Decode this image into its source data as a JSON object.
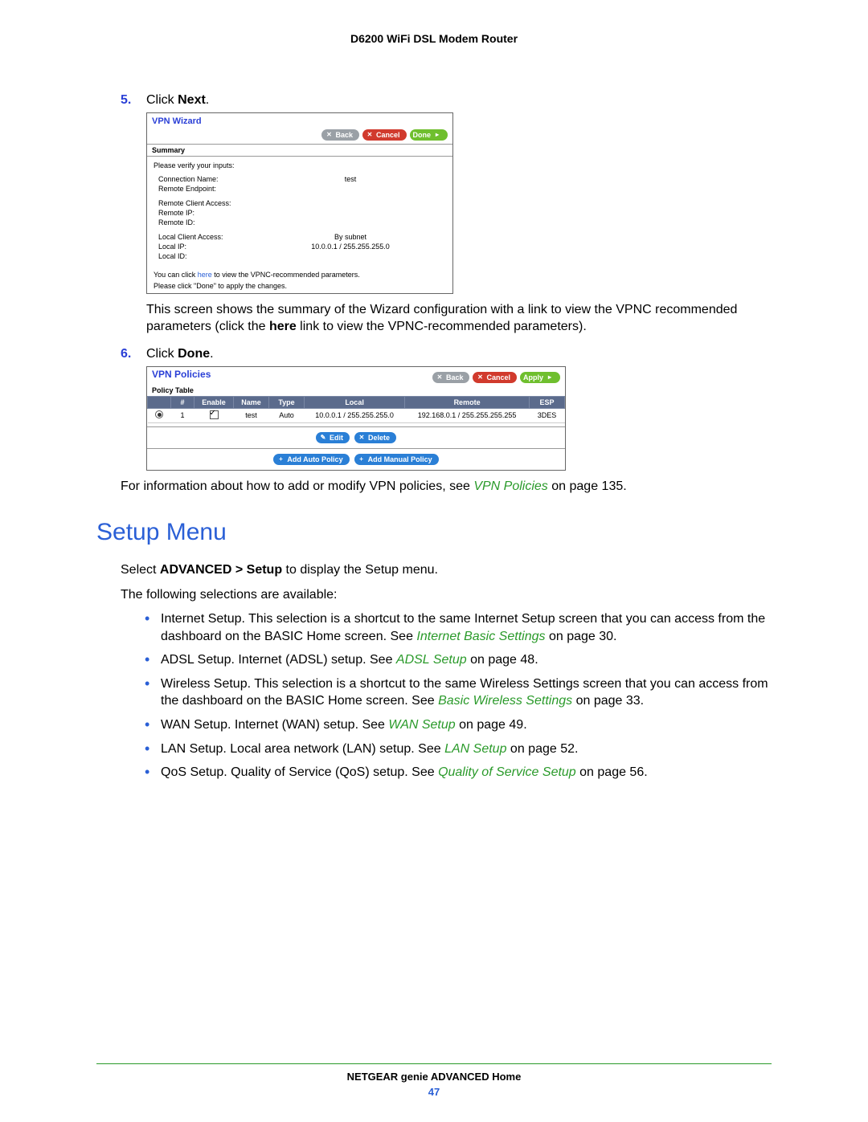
{
  "doc_header": "D6200 WiFi DSL Modem Router",
  "steps": {
    "five": {
      "num": "5.",
      "lead": "Click ",
      "bold": "Next",
      "trail": "."
    },
    "six": {
      "num": "6.",
      "lead": "Click ",
      "bold": "Done",
      "trail": "."
    }
  },
  "wizard": {
    "title": "VPN Wizard",
    "buttons": {
      "back": "Back",
      "cancel": "Cancel",
      "done": "Done"
    },
    "summary_head": "Summary",
    "verify": "Please verify your inputs:",
    "rows": {
      "conn_name": {
        "k": "Connection Name:",
        "v": "test"
      },
      "remote_ep": {
        "k": "Remote Endpoint:",
        "v": ""
      },
      "rca": {
        "k": "Remote Client Access:",
        "v": ""
      },
      "rip": {
        "k": "Remote IP:",
        "v": ""
      },
      "rid": {
        "k": "Remote ID:",
        "v": ""
      },
      "lca": {
        "k": "Local Client Access:",
        "v": "By subnet"
      },
      "lip": {
        "k": "Local IP:",
        "v": "10.0.0.1 / 255.255.255.0"
      },
      "lid": {
        "k": "Local ID:",
        "v": ""
      }
    },
    "note1a": "You can click ",
    "note1_here": "here",
    "note1b": " to view the VPNC-recommended parameters.",
    "note2": "Please click \"Done\" to apply the changes."
  },
  "wizard_caption_before": "This screen shows the summary of the Wizard configuration with a link to view the VPNC recommended parameters (click the ",
  "wizard_caption_bold": "here",
  "wizard_caption_after": " link to view the VPNC-recommended parameters).",
  "policies": {
    "title": "VPN Policies",
    "buttons": {
      "back": "Back",
      "cancel": "Cancel",
      "apply": "Apply"
    },
    "subtitle": "Policy Table",
    "headers": {
      "sel": "",
      "num": "#",
      "enable": "Enable",
      "name": "Name",
      "type": "Type",
      "local": "Local",
      "remote": "Remote",
      "esp": "ESP"
    },
    "row1": {
      "num": "1",
      "enable": true,
      "name": "test",
      "type": "Auto",
      "local": "10.0.0.1 / 255.255.255.0",
      "remote": "192.168.0.1 / 255.255.255.255",
      "esp": "3DES"
    },
    "action_buttons": {
      "edit": "Edit",
      "delete": "Delete",
      "add_auto": "Add Auto Policy",
      "add_manual": "Add Manual Policy"
    }
  },
  "policies_caption_before": "For information about how to add or modify VPN policies, see ",
  "policies_caption_link": "VPN Policies",
  "policies_caption_after": " on page 135.",
  "section_heading": "Setup Menu",
  "intro1_before": "Select ",
  "intro1_bold": "ADVANCED > Setup",
  "intro1_after": " to display the Setup menu.",
  "intro2": "The following selections are available:",
  "bullets": {
    "internet": {
      "bold": "Internet Setup",
      "before": ". This selection is a shortcut to the same Internet Setup screen that you can access from the dashboard on the BASIC Home screen. See ",
      "link": "Internet Basic Settings",
      "after": " on page 30."
    },
    "adsl": {
      "bold": "ADSL Setup",
      "before": ". Internet (ADSL) setup. See ",
      "link": "ADSL Setup",
      "after": " on page 48."
    },
    "wireless": {
      "bold": "Wireless Setup",
      "before": ". This selection is a shortcut to the same Wireless Settings screen that you can access from the dashboard on the BASIC Home screen. See ",
      "link": "Basic Wireless Settings",
      "after": " on page 33."
    },
    "wan": {
      "bold": "WAN Setup",
      "before": ". Internet (WAN) setup. See ",
      "link": "WAN Setup",
      "after": " on page 49."
    },
    "lan": {
      "bold": "LAN Setup",
      "before": ". Local area network (LAN) setup. See ",
      "link": "LAN Setup",
      "after": " on page 52."
    },
    "qos": {
      "bold": "QoS Setup",
      "before": ". Quality of Service (QoS) setup. See ",
      "link": "Quality of Service Setup",
      "after": " on page 56."
    }
  },
  "footer": {
    "title": "NETGEAR genie ADVANCED Home",
    "page": "47"
  }
}
